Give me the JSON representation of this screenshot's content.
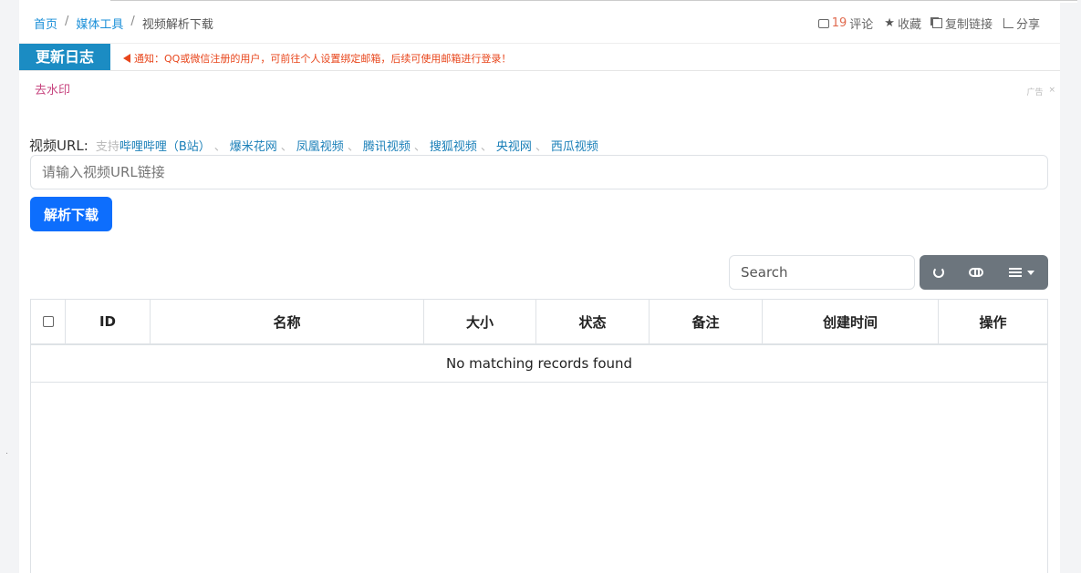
{
  "breadcrumb": {
    "home": "首页",
    "category": "媒体工具",
    "current": "视频解析下载",
    "separator": "/"
  },
  "header_actions": {
    "comment_count": "19",
    "comment_label": "评论",
    "favorite": "收藏",
    "copy_link": "复制链接",
    "share": "分享"
  },
  "notice": {
    "title": "更新日志",
    "message": "通知：QQ或微信注册的用户，可前往个人设置绑定邮箱，后续可使用邮箱进行登录！"
  },
  "watermark_link": "去水印",
  "ad_label": "广告",
  "ad_close": "×",
  "form": {
    "label": "视频URL:",
    "support_prefix": "支持",
    "platforms": [
      "哔哩哔哩（B站）",
      "爆米花网",
      "凤凰视频",
      "腾讯视频",
      "搜狐视频",
      "央视网",
      "西瓜视频"
    ],
    "sep": "、",
    "url_placeholder": "请输入视频URL链接",
    "submit": "解析下载"
  },
  "table": {
    "search_placeholder": "Search",
    "columns": [
      "ID",
      "名称",
      "大小",
      "状态",
      "备注",
      "创建时间",
      "操作"
    ],
    "empty_text": "No matching records found"
  },
  "icons": {
    "comment": "comment-icon",
    "favorite": "star-icon",
    "copy": "copy-icon",
    "share": "share-icon",
    "refresh": "refresh-icon",
    "toggle": "toggle-icon",
    "columns": "list-icon"
  },
  "colors": {
    "primary": "#0d6efd",
    "notice_bg": "#1b8cc3",
    "notice_text": "#e8461c",
    "link": "#1a8fd8",
    "toolbar": "#6c757d"
  }
}
